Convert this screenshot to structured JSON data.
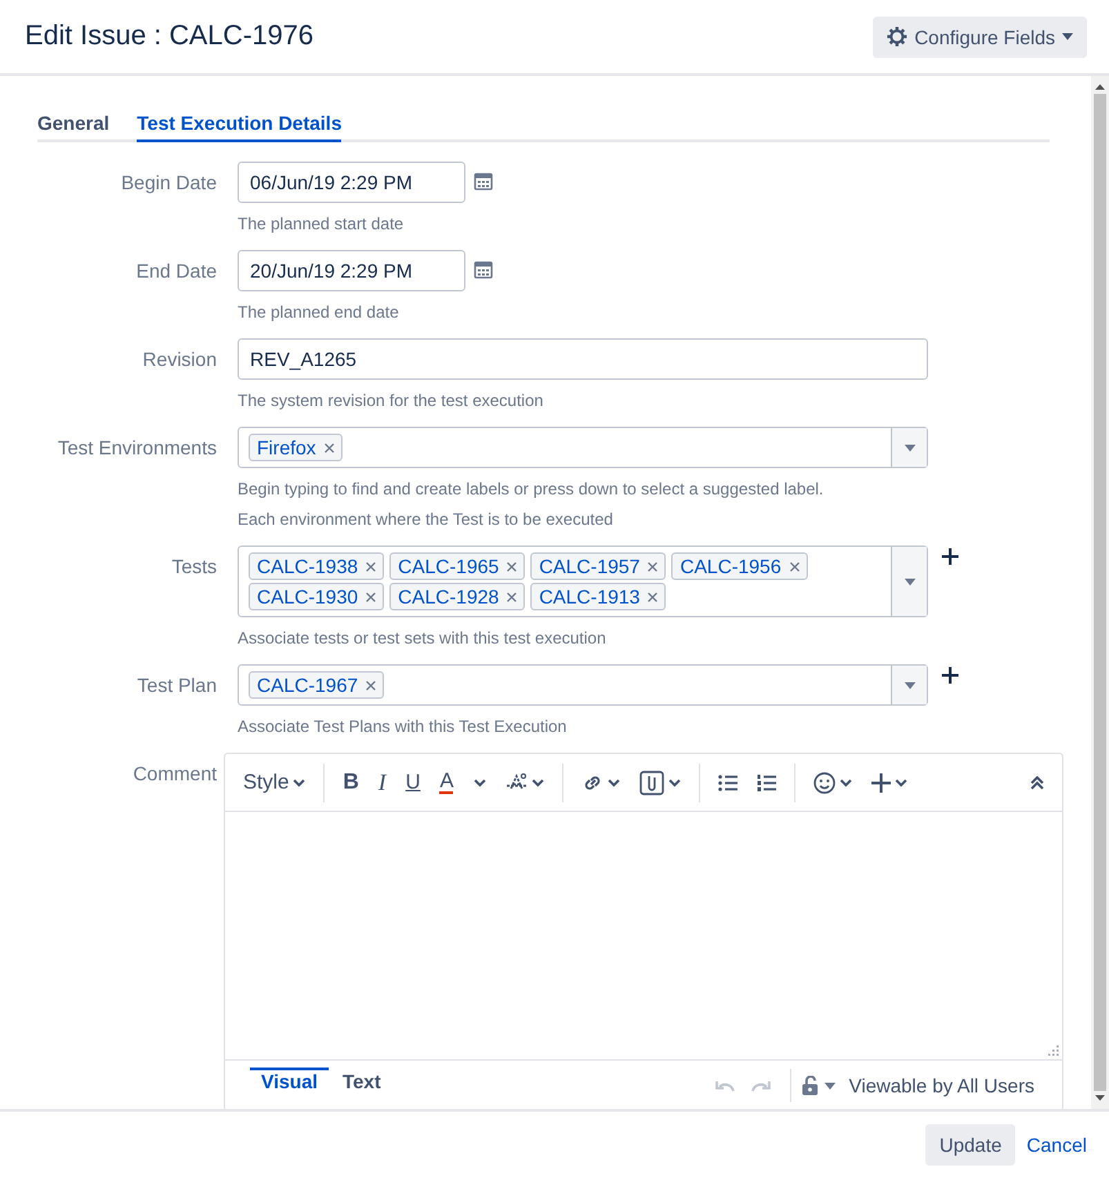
{
  "window": {
    "title": "Edit Issue : CALC-1976"
  },
  "configure_button": {
    "label": "Configure Fields"
  },
  "tabs": [
    {
      "label": "General",
      "selected": false
    },
    {
      "label": "Test Execution Details",
      "selected": true
    }
  ],
  "fields": [
    {
      "kind": "date",
      "label": "Begin Date",
      "value": "06/Jun/19 2:29 PM",
      "help": [
        "The planned start date"
      ]
    },
    {
      "kind": "date",
      "label": "End Date",
      "value": "20/Jun/19 2:29 PM",
      "help": [
        "The planned end date"
      ]
    },
    {
      "kind": "text",
      "label": "Revision",
      "value": "REV_A1265",
      "help": [
        "The system revision for the test execution"
      ]
    },
    {
      "kind": "tags",
      "label": "Test Environments",
      "tags": [
        "Firefox"
      ],
      "add": false,
      "help": [
        "Begin typing to find and create labels or press down to select a suggested label.",
        "Each environment where the Test is to be executed"
      ]
    },
    {
      "kind": "tags",
      "label": "Tests",
      "tags": [
        "CALC-1938",
        "CALC-1965",
        "CALC-1957",
        "CALC-1956",
        "CALC-1930",
        "CALC-1928",
        "CALC-1913"
      ],
      "add": true,
      "help": [
        "Associate tests or test sets with this test execution"
      ]
    },
    {
      "kind": "tags",
      "label": "Test Plan",
      "tags": [
        "CALC-1967"
      ],
      "add": true,
      "help": [
        "Associate Test Plans with this Test Execution"
      ]
    }
  ],
  "comment": {
    "label": "Comment",
    "toolbar": [
      {
        "kind": "style",
        "label": "Style"
      },
      {
        "kind": "sep"
      },
      {
        "kind": "bold",
        "label": "B"
      },
      {
        "kind": "italic",
        "label": "I"
      },
      {
        "kind": "underline",
        "label": "U"
      },
      {
        "kind": "color",
        "label": "A"
      },
      {
        "kind": "format"
      },
      {
        "kind": "sep"
      },
      {
        "kind": "link"
      },
      {
        "kind": "attach"
      },
      {
        "kind": "sep"
      },
      {
        "kind": "bullets"
      },
      {
        "kind": "numbers"
      },
      {
        "kind": "sep"
      },
      {
        "kind": "emoji"
      },
      {
        "kind": "plus"
      },
      {
        "kind": "spacer"
      },
      {
        "kind": "collapse"
      }
    ],
    "modes": [
      {
        "label": "Visual",
        "selected": true
      },
      {
        "label": "Text",
        "selected": false
      }
    ],
    "undo_disabled": true,
    "redo_disabled": true,
    "visibility": "Viewable by All Users"
  },
  "footer": {
    "update": "Update",
    "cancel": "Cancel"
  }
}
